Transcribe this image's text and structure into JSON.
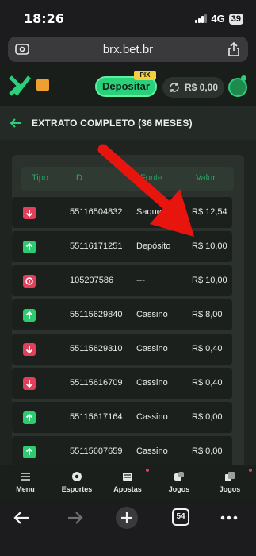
{
  "status_bar": {
    "time": "18:26",
    "network": "4G",
    "battery": "39"
  },
  "browser": {
    "url": "brx.bet.br"
  },
  "header": {
    "deposit_label": "Depositar",
    "pix_badge": "PIX",
    "balance": "R$ 0,00",
    "accent_color": "#2ad17a"
  },
  "page": {
    "title": "EXTRATO COMPLETO (36 MESES)"
  },
  "statement": {
    "columns": [
      "Tipo",
      "ID",
      "Fonte",
      "Valor"
    ],
    "rows": [
      {
        "type": "out",
        "id": "55116504832",
        "source": "Saque",
        "value": "R$ 12,54"
      },
      {
        "type": "in",
        "id": "55116171251",
        "source": "Depósito",
        "value": "R$ 10,00"
      },
      {
        "type": "bonus",
        "id": "105207586",
        "source": "---",
        "value": "R$ 10,00"
      },
      {
        "type": "in",
        "id": "55115629840",
        "source": "Cassino",
        "value": "R$ 8,00"
      },
      {
        "type": "out",
        "id": "55115629310",
        "source": "Cassino",
        "value": "R$ 0,40"
      },
      {
        "type": "out",
        "id": "55115616709",
        "source": "Cassino",
        "value": "R$ 0,40"
      },
      {
        "type": "in",
        "id": "55115617164",
        "source": "Cassino",
        "value": "R$ 0,00"
      },
      {
        "type": "in",
        "id": "55115607659",
        "source": "Cassino",
        "value": "R$ 0,00"
      }
    ]
  },
  "bottom_nav": [
    "Menu",
    "Esportes",
    "Apostas",
    "Jogos",
    "Jogos"
  ],
  "toolbar": {
    "tabs_count": "54"
  },
  "colors": {
    "in": "#2ecc71",
    "out": "#e0405a",
    "bonus": "#e0405a",
    "annotation_arrow": "#e8150f"
  }
}
